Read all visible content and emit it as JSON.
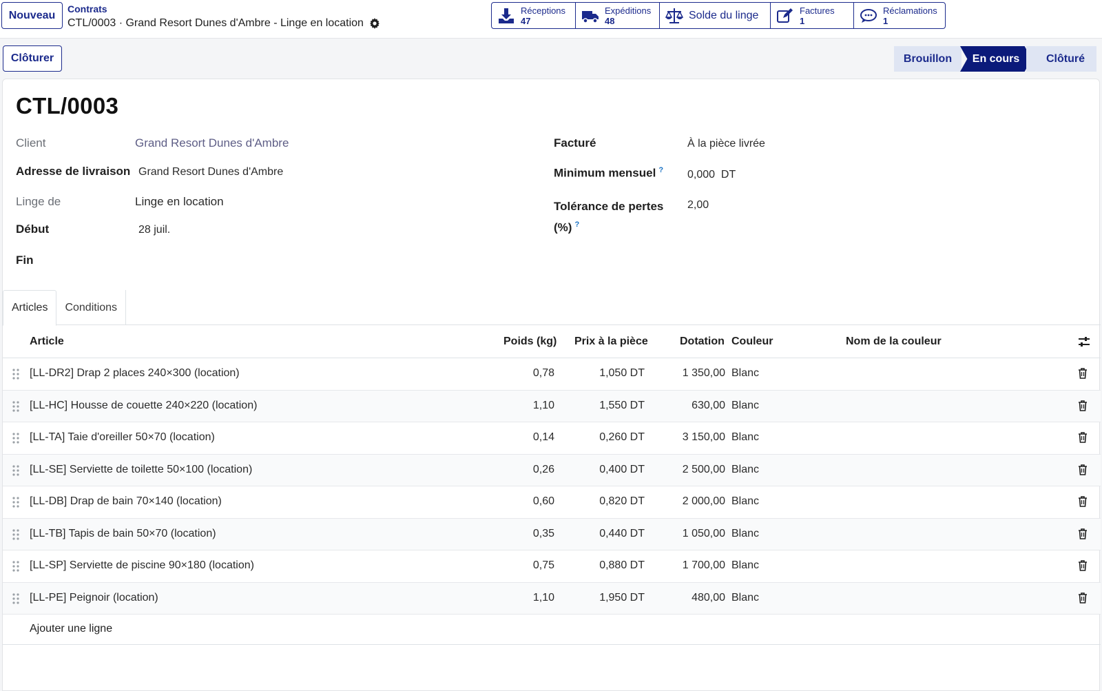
{
  "control": {
    "new_button": "Nouveau",
    "breadcrumb_parent": "Contrats",
    "breadcrumb_current": "CTL/0003 · Grand Resort Dunes d'Ambre - Linge en location"
  },
  "smart_buttons": [
    {
      "icon": "download-icon",
      "label": "Réceptions",
      "value": "47"
    },
    {
      "icon": "truck-icon",
      "label": "Expéditions",
      "value": "48"
    },
    {
      "icon": "scale-icon",
      "label": "Solde du linge",
      "value": null
    },
    {
      "icon": "pencil-square-icon",
      "label": "Factures",
      "value": "1"
    },
    {
      "icon": "comments-icon",
      "label": "Réclamations",
      "value": "1"
    }
  ],
  "actions": {
    "close_button": "Clôturer"
  },
  "statusbar": {
    "stages": [
      "Brouillon",
      "En cours",
      "Clôturé"
    ],
    "active": "En cours"
  },
  "record": {
    "title": "CTL/0003",
    "fields_left": [
      {
        "label": "Client",
        "value": "Grand Resort Dunes d'Ambre"
      },
      {
        "label": "Adresse de livraison",
        "value": "Grand Resort Dunes d'Ambre"
      },
      {
        "label": "Linge de",
        "value": "Linge en location"
      },
      {
        "label": "Début",
        "value": "28 juil."
      },
      {
        "label": "Fin",
        "value": ""
      }
    ],
    "fields_right": [
      {
        "label": "Facturé",
        "value": "À la pièce livrée"
      },
      {
        "label": "Minimum mensuel",
        "value": "0,000  DT",
        "help": "?"
      },
      {
        "label_line1": "Tolérance de pertes",
        "label_line2": "(%)",
        "value": "2,00",
        "help": "?"
      }
    ]
  },
  "tabs": [
    "Articles",
    "Conditions"
  ],
  "table": {
    "columns": [
      "Article",
      "Poids (kg)",
      "Prix à la pièce",
      "Dotation",
      "Couleur",
      "Nom de la couleur"
    ],
    "rows": [
      [
        "[LL-DR2] Drap 2 places 240×300 (location)",
        "0,78",
        "1,050 DT",
        "1 350,00",
        "Blanc",
        ""
      ],
      [
        "[LL-HC] Housse de couette 240×220 (location)",
        "1,10",
        "1,550 DT",
        "630,00",
        "Blanc",
        ""
      ],
      [
        "[LL-TA] Taie d'oreiller 50×70 (location)",
        "0,14",
        "0,260 DT",
        "3 150,00",
        "Blanc",
        ""
      ],
      [
        "[LL-SE] Serviette de toilette 50×100 (location)",
        "0,26",
        "0,400 DT",
        "2 500,00",
        "Blanc",
        ""
      ],
      [
        "[LL-DB] Drap de bain 70×140 (location)",
        "0,60",
        "0,820 DT",
        "2 000,00",
        "Blanc",
        ""
      ],
      [
        "[LL-TB] Tapis de bain 50×70 (location)",
        "0,35",
        "0,440 DT",
        "1 050,00",
        "Blanc",
        ""
      ],
      [
        "[LL-SP] Serviette de piscine 90×180 (location)",
        "0,75",
        "0,880 DT",
        "1 700,00",
        "Blanc",
        ""
      ],
      [
        "[LL-PE] Peignoir (location)",
        "1,10",
        "1,950 DT",
        "480,00",
        "Blanc",
        ""
      ]
    ],
    "add_line": "Ajouter une ligne"
  },
  "colors": {
    "brand": "#1b2a8c",
    "active_stage": "#0b1a7a",
    "inactive_stage": "#dfe5f3"
  }
}
